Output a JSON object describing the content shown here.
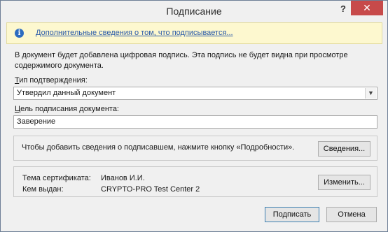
{
  "window": {
    "title": "Подписание",
    "help": "?",
    "close": "✕"
  },
  "info_bar": {
    "icon": "info-icon",
    "link_text": "Дополнительные сведения о том, что подписывается..."
  },
  "description": "В документ будет добавлена цифровая подпись. Эта подпись не будет видна при просмотре содержимого документа.",
  "commitment": {
    "label_accel": "Т",
    "label_rest": "ип подтверждения:",
    "selected": "Утвердил данный документ"
  },
  "purpose": {
    "label_accel": "Ц",
    "label_rest": "ель подписания документа:",
    "value": "Заверение"
  },
  "signer_info": {
    "text": "Чтобы добавить сведения о подписавшем, нажмите кнопку «Подробности».",
    "button": "Сведения..."
  },
  "certificate": {
    "subject_label": "Тема сертификата:",
    "subject_value": "Иванов И.И.",
    "issuer_label": "Кем выдан:",
    "issuer_value": "CRYPTO-PRO Test Center 2",
    "change_button": "Изменить..."
  },
  "footer": {
    "sign_button": "Подписать",
    "cancel_button": "Отмена"
  },
  "colors": {
    "close_button": "#c74a4a",
    "info_bar_bg": "#fdf8cf",
    "link": "#2a5aa8"
  }
}
